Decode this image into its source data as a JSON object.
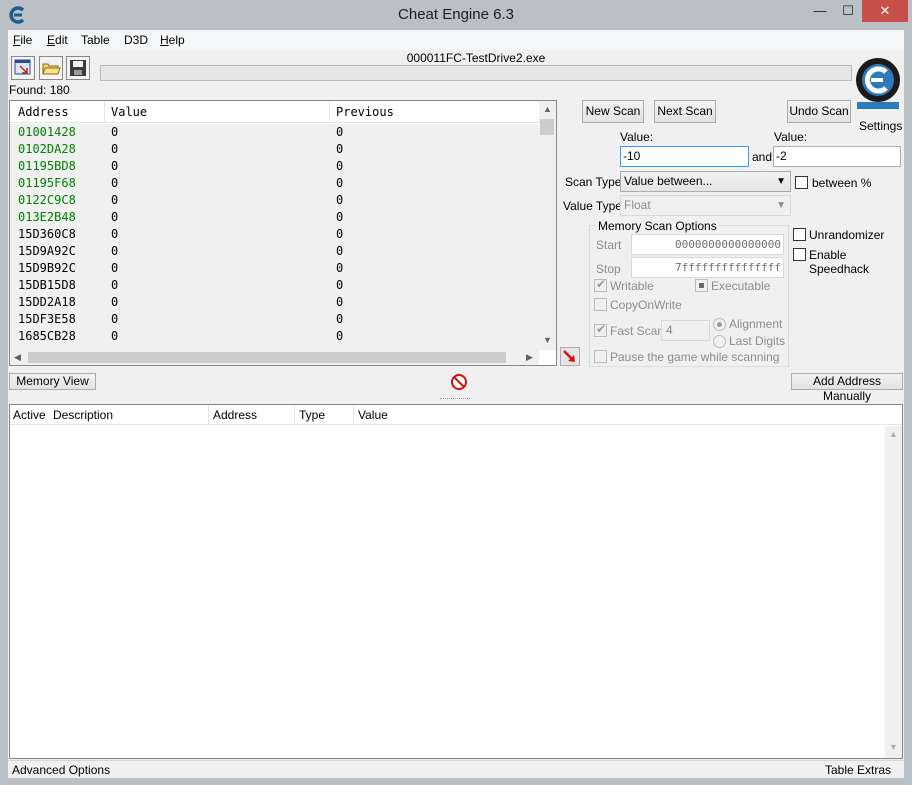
{
  "window": {
    "title": "Cheat Engine 6.3",
    "controls": {
      "minimize": "—",
      "maximize": "☐",
      "close": "✕"
    }
  },
  "menu": [
    {
      "label": "File",
      "accel": "F",
      "rest": "ile"
    },
    {
      "label": "Edit",
      "accel": "E",
      "rest": "dit"
    },
    {
      "label": "Table",
      "accel": "",
      "rest": "Table"
    },
    {
      "label": "D3D",
      "accel": "",
      "rest": "D3D"
    },
    {
      "label": "Help",
      "accel": "H",
      "rest": "elp"
    }
  ],
  "toolbar": {
    "icons": [
      "open-process-icon",
      "open-file-icon",
      "save-icon"
    ],
    "process_name": "000011FC-TestDrive2.exe",
    "progress_percent": 0
  },
  "found": "Found: 180",
  "results": {
    "columns": [
      "Address",
      "Value",
      "Previous"
    ],
    "rows": [
      {
        "address": "01001428",
        "value": "0",
        "previous": "0",
        "static": true
      },
      {
        "address": "0102DA28",
        "value": "0",
        "previous": "0",
        "static": true
      },
      {
        "address": "01195BD8",
        "value": "0",
        "previous": "0",
        "static": true
      },
      {
        "address": "01195F68",
        "value": "0",
        "previous": "0",
        "static": true
      },
      {
        "address": "0122C9C8",
        "value": "0",
        "previous": "0",
        "static": true
      },
      {
        "address": "013E2B48",
        "value": "0",
        "previous": "0",
        "static": true
      },
      {
        "address": "15D360C8",
        "value": "0",
        "previous": "0",
        "static": false
      },
      {
        "address": "15D9A92C",
        "value": "0",
        "previous": "0",
        "static": false
      },
      {
        "address": "15D9B92C",
        "value": "0",
        "previous": "0",
        "static": false
      },
      {
        "address": "15DB15D8",
        "value": "0",
        "previous": "0",
        "static": false
      },
      {
        "address": "15DD2A18",
        "value": "0",
        "previous": "0",
        "static": false
      },
      {
        "address": "15DF3E58",
        "value": "0",
        "previous": "0",
        "static": false
      },
      {
        "address": "1685CB28",
        "value": "0",
        "previous": "0",
        "static": false
      }
    ],
    "static_color": "#008000"
  },
  "scan": {
    "new_scan": "New Scan",
    "next_scan": "Next Scan",
    "undo_scan": "Undo Scan",
    "settings": "Settings",
    "logo_text": "Cheat Engine",
    "value_label_1": "Value:",
    "value_label_2": "Value:",
    "value_1": "-10",
    "and_label": "and",
    "value_2": "-2",
    "between_percent": "between %",
    "scan_type_label": "Scan Type",
    "scan_type_value": "Value between...",
    "value_type_label": "Value Type",
    "value_type_value": "Float",
    "memory_scan_options": "Memory Scan Options",
    "start_label": "Start",
    "start_value": "0000000000000000",
    "stop_label": "Stop",
    "stop_value": "7fffffffffffffff",
    "writable": "Writable",
    "executable": "Executable",
    "copy_on_write": "CopyOnWrite",
    "fast_scan": "Fast Scan",
    "fast_scan_value": "4",
    "alignment": "Alignment",
    "last_digits": "Last Digits",
    "pause_game": "Pause the game while scanning",
    "unrandomizer": "Unrandomizer",
    "enable_speedhack": "Enable Speedhack"
  },
  "bottom_toolbar": {
    "memory_view": "Memory View",
    "add_address_manually": "Add Address Manually"
  },
  "address_list": {
    "columns": [
      "Active",
      "Description",
      "Address",
      "Type",
      "Value"
    ]
  },
  "status": {
    "advanced_options": "Advanced Options",
    "table_extras": "Table Extras"
  }
}
